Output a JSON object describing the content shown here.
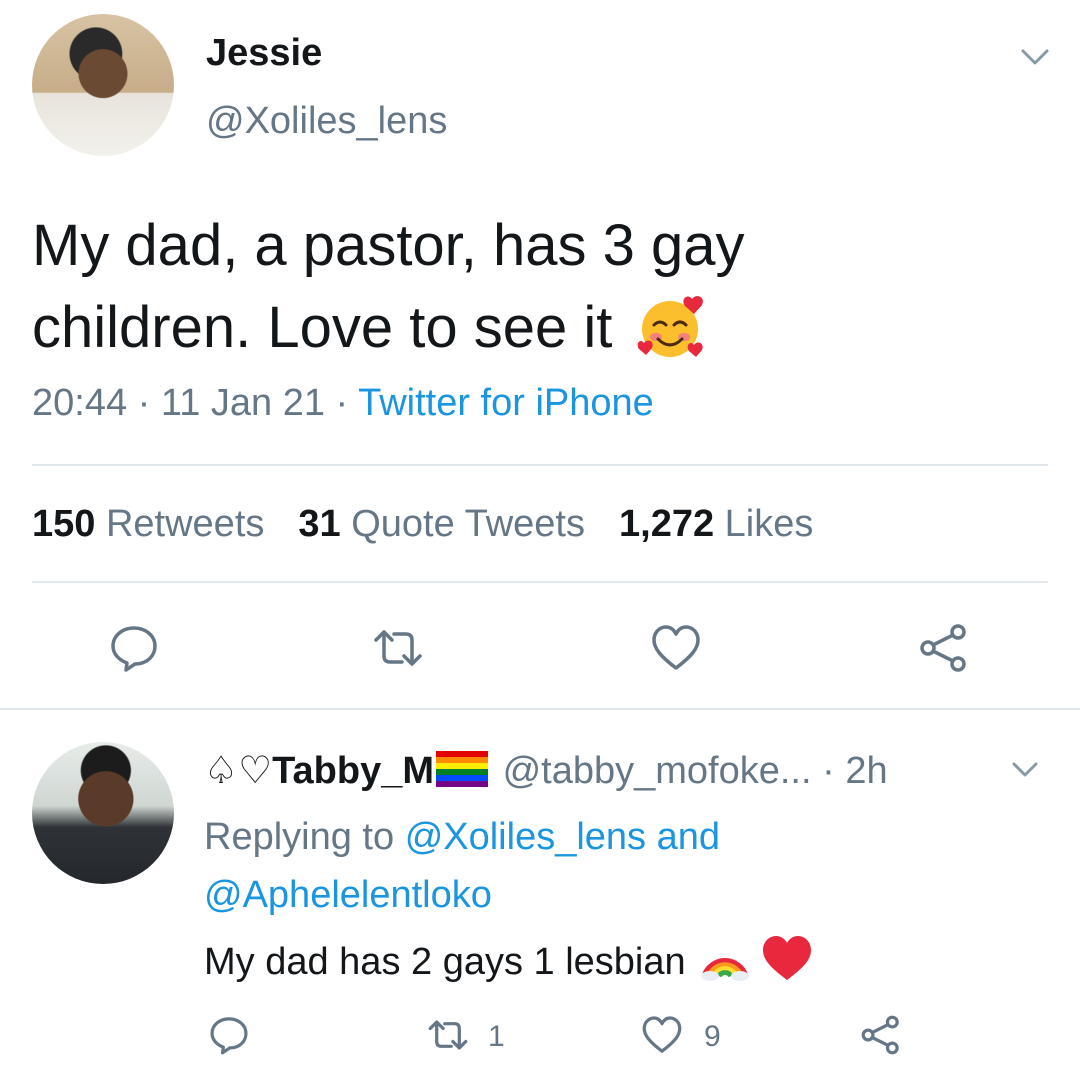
{
  "main_tweet": {
    "display_name": "Jessie",
    "handle": "@Xoliles_lens",
    "text_line1": "My dad, a pastor, has 3 gay",
    "text_line2": "children. Love to see it",
    "text_emoji": "smiling-face-with-hearts",
    "time": "20:44",
    "sep1": " · ",
    "date": "11 Jan 21",
    "sep2": " · ",
    "source": "Twitter for iPhone",
    "stats": {
      "retweets_count": "150",
      "retweets_label": "Retweets",
      "quotes_count": "31",
      "quotes_label": "Quote Tweets",
      "likes_count": "1,272",
      "likes_label": "Likes"
    },
    "icons": [
      "reply-icon",
      "retweet-icon",
      "like-icon",
      "share-icon"
    ]
  },
  "reply_tweet": {
    "name_prefix_symbols": "♤♡",
    "display_name": "Tabby_M",
    "name_emoji": "rainbow-flag",
    "handle": "@tabby_mofoke...",
    "time_sep": " · ",
    "time": "2h",
    "replying_label": "Replying to",
    "replying_user1": "@Xoliles_lens",
    "replying_and": "and",
    "replying_user2": "@Aphelelentloko",
    "text": "My dad has 2 gays 1 lesbian",
    "text_emojis": [
      "rainbow",
      "red-heart"
    ],
    "retweet_count": "1",
    "like_count": "9"
  },
  "colors": {
    "text": "#14171a",
    "secondary": "#657786",
    "link": "#1b95e0",
    "divider": "#e1e8ed"
  }
}
